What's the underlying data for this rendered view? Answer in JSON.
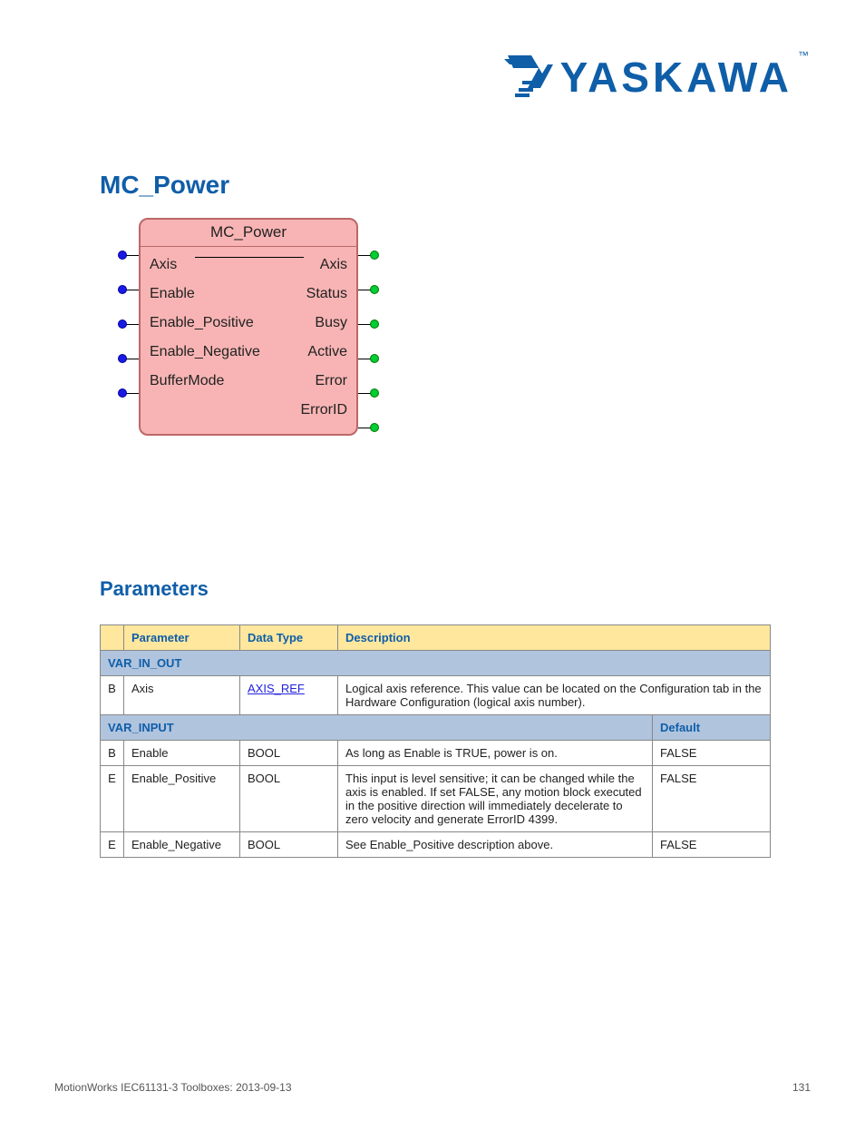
{
  "logo": {
    "text": "YASKAWA",
    "tm": "™"
  },
  "page_title": "MC_Power",
  "function_block": {
    "title": "MC_Power",
    "inputs": [
      "Axis",
      "Enable",
      "Enable_Positive",
      "Enable_Negative",
      "BufferMode"
    ],
    "outputs": [
      "Axis",
      "Status",
      "Busy",
      "Active",
      "Error",
      "ErrorID"
    ]
  },
  "parameters_heading": "Parameters",
  "table": {
    "headers": [
      "",
      "Parameter",
      "Data Type",
      "Description"
    ],
    "var_in_out_label": "VAR_IN_OUT",
    "var_in_out": [
      {
        "letter": "B",
        "name": "Axis",
        "type": "AXIS_REF",
        "type_is_link": true,
        "desc": "Logical axis reference. This value can be located on the Configuration tab in the Hardware Configuration (logical axis number)."
      }
    ],
    "var_input_label": "VAR_INPUT",
    "var_input_header_last": "Default",
    "var_input": [
      {
        "letter": "B",
        "name": "Enable",
        "type": "BOOL",
        "desc": "As long as Enable is TRUE, power is on.",
        "default": "FALSE"
      },
      {
        "letter": "E",
        "name": "Enable_Positive",
        "type": "BOOL",
        "desc": "This input is level sensitive; it can be changed while the axis is enabled. If set FALSE, any motion block executed in the positive direction will immediately decelerate to zero velocity and generate ErrorID 4399.",
        "default": "FALSE"
      },
      {
        "letter": "E",
        "name": "Enable_Negative",
        "type": "BOOL",
        "desc": "See Enable_Positive description above.",
        "default": "FALSE"
      }
    ]
  },
  "footer": {
    "left": "MotionWorks IEC61131-3 Toolboxes: 2013-09-13",
    "right": "131"
  }
}
